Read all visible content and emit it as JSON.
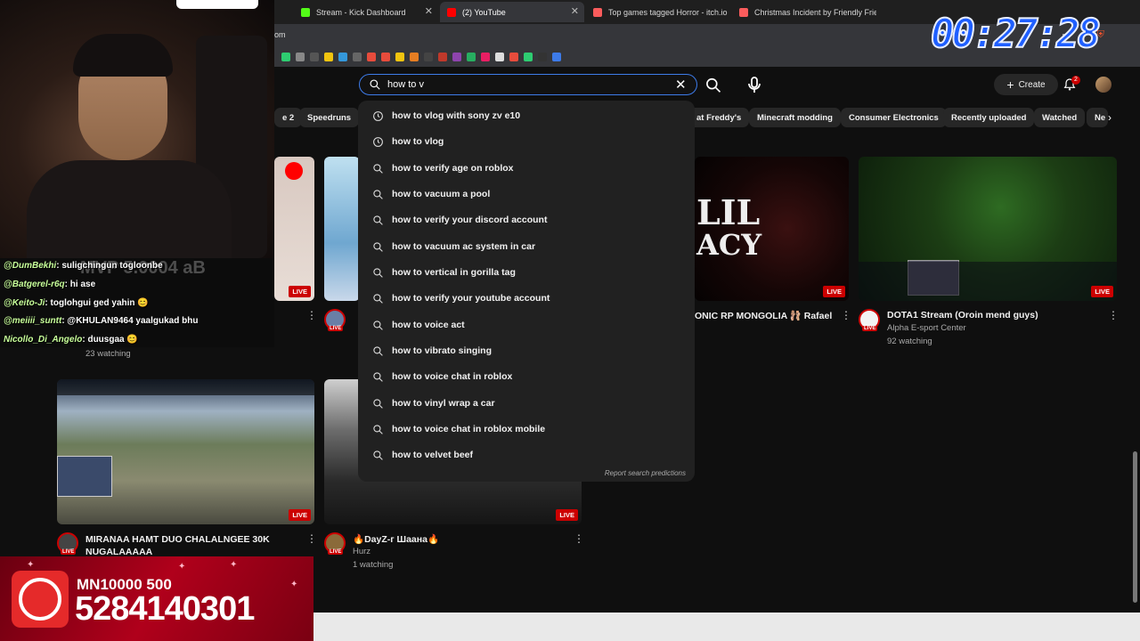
{
  "browser": {
    "tabs": [
      {
        "label": "Stream - Kick Dashboard",
        "color": "#53fc18"
      },
      {
        "label": "(2) YouTube",
        "color": "#ff0000"
      },
      {
        "label": "Top games tagged Horror - itch.io",
        "color": "#fa5c5c"
      },
      {
        "label": "Christmas Incident by Friendly Friend",
        "color": "#fa5c5c"
      }
    ],
    "new_tab": "+",
    "url_fragment": "om"
  },
  "youtube": {
    "search": {
      "query": "how to v",
      "clear": "✕"
    },
    "create_label": "Create",
    "notification_count": "2",
    "chips": [
      "e 2",
      "Speedruns",
      "at Freddy's",
      "Minecraft modding",
      "Consumer Electronics",
      "Recently uploaded",
      "Watched",
      "Ne"
    ],
    "suggestions": [
      {
        "text": "how to vlog with sony zv e10",
        "type": "history"
      },
      {
        "text": "how to vlog",
        "type": "history"
      },
      {
        "text": "how to verify age on roblox",
        "type": "search"
      },
      {
        "text": "how to vacuum a pool",
        "type": "search"
      },
      {
        "text": "how to verify your discord account",
        "type": "search"
      },
      {
        "text": "how to vacuum ac system in car",
        "type": "search"
      },
      {
        "text": "how to vertical in gorilla tag",
        "type": "search"
      },
      {
        "text": "how to verify your youtube account",
        "type": "search"
      },
      {
        "text": "how to voice act",
        "type": "search"
      },
      {
        "text": "how to vibrato singing",
        "type": "search"
      },
      {
        "text": "how to voice chat in roblox",
        "type": "search"
      },
      {
        "text": "how to vinyl wrap a car",
        "type": "search"
      },
      {
        "text": "how to voice chat in roblox mobile",
        "type": "search"
      },
      {
        "text": "how to velvet beef",
        "type": "search"
      }
    ],
    "report_label": "Report search predictions",
    "live_label": "LIVE",
    "videos": {
      "v1": {
        "title_tail": "ONIC RP MONGOLIA 🩰 Rafael"
      },
      "v2": {
        "title": "DOTA1 Stream (Oroin mend guys)",
        "channel": "Alpha E-sport Center",
        "stats": "92 watching"
      },
      "v3": {
        "stats": "23 watching"
      },
      "v4": {
        "title": "MIRANAA HAMT DUO CHALALNGEE 30K NUGALAAAAA"
      },
      "v5": {
        "title": "🔥DayZ-г Шаана🔥",
        "channel": "Hurz",
        "stats": "1 watching"
      }
    },
    "thumb_text": {
      "lil": "LIL",
      "acy": "ACY"
    }
  },
  "overlay": {
    "timer": "00:27:28",
    "chat": [
      {
        "user": "@DumBekhi",
        "msg": ": suligchingun togloonbe"
      },
      {
        "user": "@Batgerel-r6q",
        "msg": ": hi ase"
      },
      {
        "user": "@Keito-Ji",
        "msg": ": toglohgui ged yahin 😊"
      },
      {
        "user": "@meiiii_suntt",
        "msg": ": @KHULAN9464 yaalgukad bhu"
      },
      {
        "user": "Nicollo_Di_Angelo",
        "msg": ": duusgaa 😊"
      }
    ],
    "chat_ghost": "MVP 5.0004 aB",
    "donation": {
      "line1": "MN10000 500",
      "line2": "5284140301"
    }
  }
}
